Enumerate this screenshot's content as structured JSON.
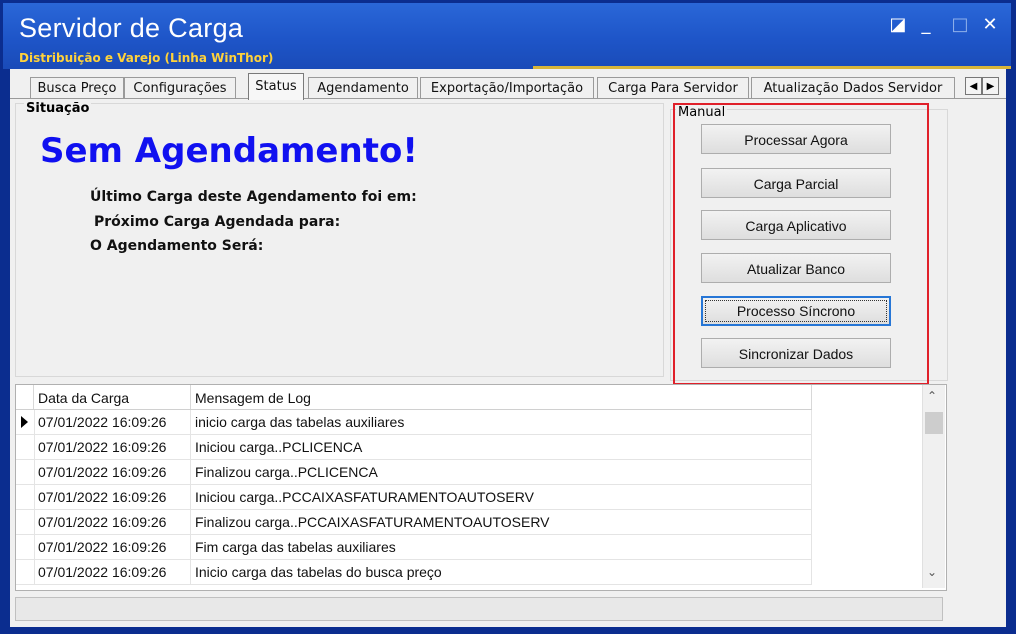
{
  "window": {
    "title": "Servidor de Carga",
    "subtitle": "Distribuição e Varejo (Linha WinThor)",
    "controls": {
      "restore": "◪",
      "minimize": "_",
      "maximize": "□",
      "close": "✕"
    }
  },
  "tabs": [
    {
      "label": "Busca Preço"
    },
    {
      "label": "Configurações"
    },
    {
      "label": "Status",
      "active": true
    },
    {
      "label": "Agendamento"
    },
    {
      "label": "Exportação/Importação"
    },
    {
      "label": "Carga Para Servidor"
    },
    {
      "label": "Atualização Dados Servidor"
    }
  ],
  "tab_scroll": {
    "left": "◀",
    "right": "▶"
  },
  "situacao": {
    "group_label": "Situação",
    "status": "Sem Agendamento!",
    "last_load": "Último Carga deste Agendamento foi em:",
    "next_load": "Próximo Carga Agendada para:",
    "will_be": "O Agendamento Será:"
  },
  "manual": {
    "group_label": "Manual",
    "buttons": [
      "Processar Agora",
      "Carga Parcial",
      "Carga Aplicativo",
      "Atualizar Banco",
      "Processo Síncrono",
      "Sincronizar Dados"
    ]
  },
  "log": {
    "columns": [
      "Data da Carga",
      "Mensagem de  Log"
    ],
    "rows": [
      [
        "07/01/2022 16:09:26",
        "inicio carga das tabelas auxiliares"
      ],
      [
        "07/01/2022 16:09:26",
        "Iniciou carga..PCLICENCA"
      ],
      [
        "07/01/2022 16:09:26",
        "Finalizou carga..PCLICENCA"
      ],
      [
        "07/01/2022 16:09:26",
        "Iniciou carga..PCCAIXASFATURAMENTOAUTOSERV"
      ],
      [
        "07/01/2022 16:09:26",
        "Finalizou carga..PCCAIXASFATURAMENTOAUTOSERV"
      ],
      [
        "07/01/2022 16:09:26",
        "Fim carga das tabelas auxiliares"
      ],
      [
        "07/01/2022 16:09:26",
        "Inicio carga das tabelas do busca preço"
      ]
    ],
    "scroll_up": "⌃",
    "scroll_down": "⌄"
  },
  "colors": {
    "title_bg": "#1e55c8",
    "subtitle": "#ffd23a",
    "status_text": "#1010f0",
    "highlight": "#e0202a"
  }
}
